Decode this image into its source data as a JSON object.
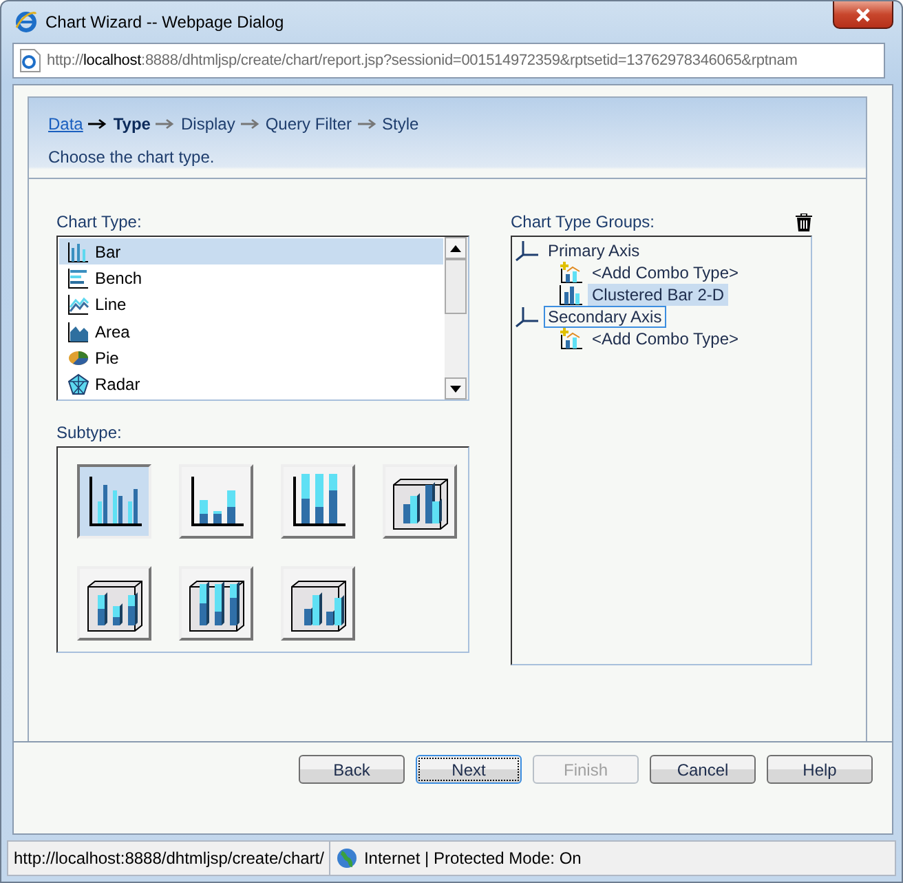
{
  "window": {
    "title": "Chart Wizard -- Webpage Dialog"
  },
  "address_bar": {
    "url": "http://**localhost**:8888/dhtmljsp/create/chart/report.jsp?sessionid=001514972359&rptsetid=13762978346065&rptnam"
  },
  "steps": [
    {
      "label": "Data",
      "completed": true,
      "selected": false
    },
    {
      "label": "Type",
      "completed": false,
      "selected": true
    },
    {
      "label": "Display",
      "completed": false,
      "selected": false
    },
    {
      "label": "Query Filter",
      "completed": false,
      "selected": false
    },
    {
      "label": "Style",
      "completed": false,
      "selected": false
    }
  ],
  "description": "Choose the chart type.",
  "chart_type": {
    "label": "Chart Type:",
    "items": [
      {
        "label": "Bar",
        "kind": "bar",
        "selected": true
      },
      {
        "label": "Bench",
        "kind": "bench",
        "selected": false
      },
      {
        "label": "Line",
        "kind": "line",
        "selected": false
      },
      {
        "label": "Area",
        "kind": "area",
        "selected": false
      },
      {
        "label": "Pie",
        "kind": "pie",
        "selected": false
      },
      {
        "label": "Radar",
        "kind": "radar",
        "selected": false
      }
    ]
  },
  "subtype": {
    "label": "Subtype:",
    "items": [
      {
        "kind": "clustered",
        "selected": true
      },
      {
        "kind": "stacked",
        "selected": false
      },
      {
        "kind": "percent",
        "selected": false
      },
      {
        "kind": "clustered-3d",
        "selected": false
      },
      {
        "kind": "stacked-3d",
        "selected": false
      },
      {
        "kind": "percent-3d",
        "selected": false
      },
      {
        "kind": "depth-3d",
        "selected": false
      }
    ]
  },
  "groups": {
    "label": "Chart Type Groups:",
    "tree": [
      {
        "label": "Primary Axis",
        "kind": "axis",
        "selected": false,
        "focused": false,
        "children": [
          {
            "label": "<Add Combo Type>",
            "kind": "add",
            "selected": false,
            "focused": false
          },
          {
            "label": "Clustered Bar 2-D",
            "kind": "bar",
            "selected": true,
            "focused": false
          }
        ]
      },
      {
        "label": "Secondary Axis",
        "kind": "axis",
        "selected": false,
        "focused": true,
        "children": [
          {
            "label": "<Add Combo Type>",
            "kind": "add",
            "selected": false,
            "focused": false
          }
        ]
      }
    ]
  },
  "buttons": [
    {
      "label": "Back",
      "disabled": false,
      "focused": false
    },
    {
      "label": "Next",
      "disabled": false,
      "focused": true
    },
    {
      "label": "Finish",
      "disabled": true,
      "focused": false
    },
    {
      "label": "Cancel",
      "disabled": false,
      "focused": false
    },
    {
      "label": "Help",
      "disabled": false,
      "focused": false
    }
  ],
  "status_bar": {
    "url": "http://localhost:8888/dhtmljsp/create/chart/",
    "zone": "Internet | Protected Mode: On"
  }
}
